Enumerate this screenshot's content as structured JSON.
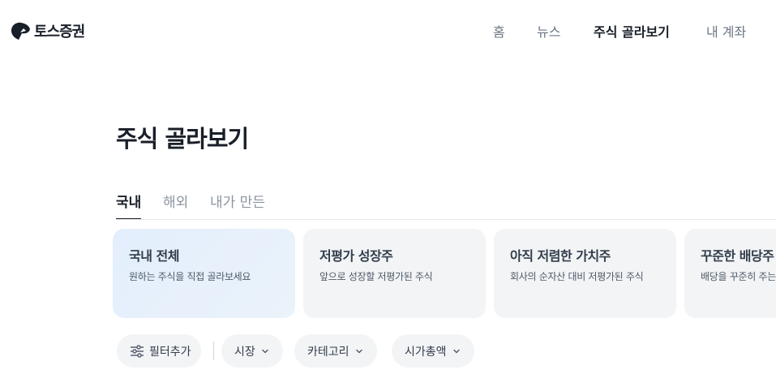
{
  "header": {
    "logo_text": "토스증권",
    "nav": [
      {
        "label": "홈",
        "active": false
      },
      {
        "label": "뉴스",
        "active": false
      },
      {
        "label": "주식 골라보기",
        "active": true
      },
      {
        "label": "내 계좌",
        "active": false
      }
    ]
  },
  "main": {
    "title": "주식 골라보기",
    "tabs": [
      {
        "label": "국내",
        "active": true
      },
      {
        "label": "해외",
        "active": false
      },
      {
        "label": "내가 만든",
        "active": false
      }
    ],
    "cards": [
      {
        "title": "국내 전체",
        "desc": "원하는 주식을 직접 골라보세요",
        "active": true
      },
      {
        "title": "저평가 성장주",
        "desc": "앞으로 성장할 저평가된 주식",
        "active": false
      },
      {
        "title": "아직 저렴한 가치주",
        "desc": "회사의 순자산 대비 저평가된 주식",
        "active": false
      },
      {
        "title": "꾸준한 배당주",
        "desc": "배당을 꾸준히 주는",
        "active": false
      }
    ],
    "filters": {
      "add_label": "필터추가",
      "chips": [
        {
          "label": "시장"
        },
        {
          "label": "카테고리"
        },
        {
          "label": "시가총액"
        }
      ]
    }
  },
  "colors": {
    "text_primary": "#191f28",
    "text_secondary": "#6b7684",
    "card_bg": "#f2f4f6",
    "card_active_bg": "#e3eefc"
  }
}
